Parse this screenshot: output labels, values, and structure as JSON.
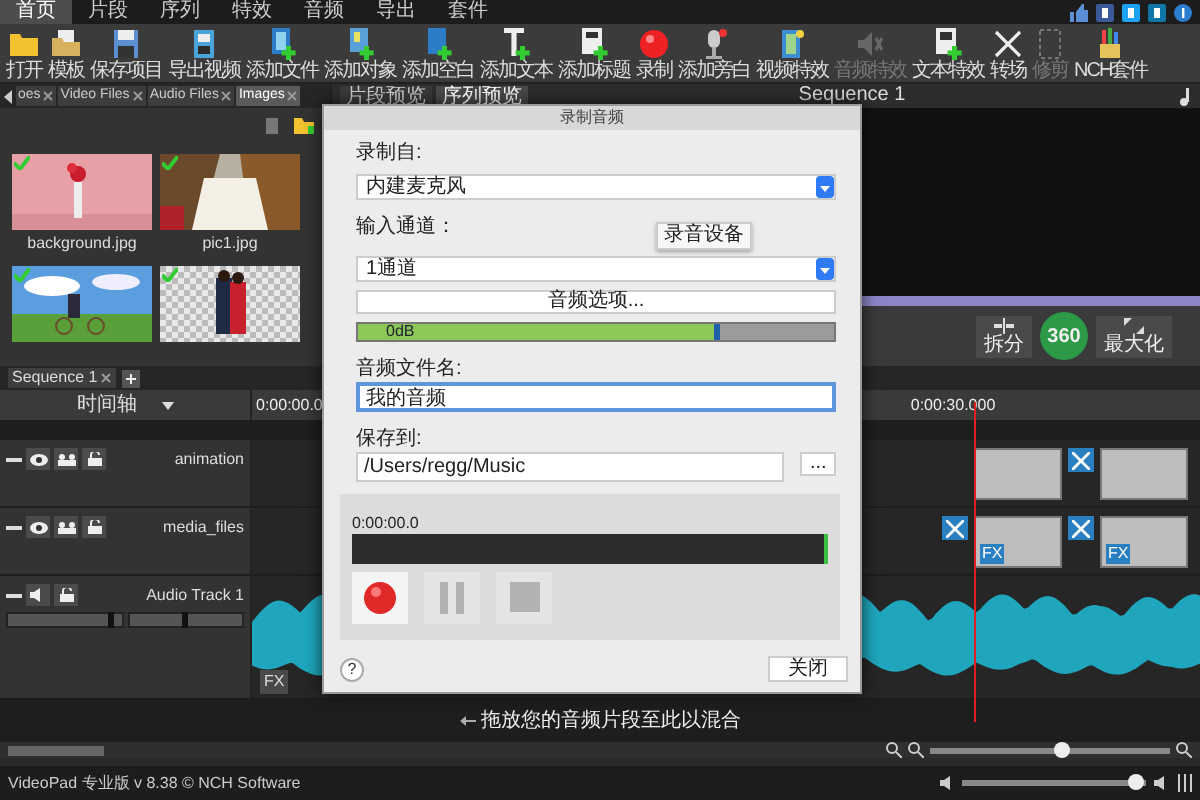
{
  "menu_tabs": [
    {
      "label": "首页",
      "selected": true
    },
    {
      "label": "片段",
      "selected": false
    },
    {
      "label": "序列",
      "selected": false
    },
    {
      "label": "特效",
      "selected": false
    },
    {
      "label": "音频",
      "selected": false
    },
    {
      "label": "导出",
      "selected": false
    },
    {
      "label": "套件",
      "selected": false
    }
  ],
  "toolbar": [
    {
      "label": "打开",
      "kind": "open",
      "disabled": false
    },
    {
      "label": "模板",
      "kind": "template",
      "disabled": false
    },
    {
      "label": "保存项目",
      "kind": "save",
      "disabled": false
    },
    {
      "label": "导出视频",
      "kind": "export",
      "disabled": false
    },
    {
      "label": "添加文件",
      "kind": "addfile",
      "disabled": false
    },
    {
      "label": "添加对象",
      "kind": "addobject",
      "disabled": false
    },
    {
      "label": "添加空白",
      "kind": "addblank",
      "disabled": false
    },
    {
      "label": "添加文本",
      "kind": "addtext",
      "disabled": false
    },
    {
      "label": "添加标题",
      "kind": "addtitle",
      "disabled": false
    },
    {
      "label": "录制",
      "kind": "record",
      "disabled": false
    },
    {
      "label": "添加旁白",
      "kind": "narration",
      "disabled": false
    },
    {
      "label": "视频特效",
      "kind": "vfx",
      "disabled": false
    },
    {
      "label": "音频特效",
      "kind": "afx",
      "disabled": true
    },
    {
      "label": "文本特效",
      "kind": "tfx",
      "disabled": false
    },
    {
      "label": "转场",
      "kind": "transition",
      "disabled": false
    },
    {
      "label": "修剪",
      "kind": "trim",
      "disabled": true
    },
    {
      "label": "NCH套件",
      "kind": "suite",
      "disabled": false
    }
  ],
  "media_tabs": [
    {
      "label": "oes",
      "selected": false
    },
    {
      "label": "Video Files",
      "selected": false
    },
    {
      "label": "Audio Files",
      "selected": false
    },
    {
      "label": "Images",
      "selected": true
    }
  ],
  "media_items": [
    {
      "caption": "background.jpg",
      "checked": true,
      "kind": "wall"
    },
    {
      "caption": "pic1.jpg",
      "checked": true,
      "kind": "dress"
    },
    {
      "checked": true,
      "kind": "field"
    },
    {
      "checked": true,
      "kind": "cutout"
    }
  ],
  "preview": {
    "tabs": [
      {
        "label": "片段预览",
        "selected": false
      },
      {
        "label": "序列预览",
        "selected": true
      }
    ],
    "title": "Sequence 1",
    "buttons": [
      {
        "label": "拆分",
        "kind": "split"
      },
      {
        "label": "360",
        "kind": "vr"
      },
      {
        "label": "最大化",
        "kind": "max"
      }
    ]
  },
  "timeline": {
    "sequence_tab": "Sequence 1",
    "mode": "时间轴",
    "times": [
      "0:00:00.0",
      "0:00:30.000"
    ],
    "tracks": [
      {
        "name": "animation",
        "kind": "video",
        "items": [
          {
            "kind": "clip"
          },
          {
            "kind": "transition"
          },
          {
            "kind": "clip"
          }
        ]
      },
      {
        "name": "media_files",
        "kind": "video",
        "items": [
          {
            "kind": "transition"
          },
          {
            "kind": "clip",
            "fx": "FX"
          },
          {
            "kind": "transition"
          },
          {
            "kind": "clip",
            "fx": "FX"
          }
        ]
      },
      {
        "name": "Audio Track 1",
        "kind": "audio",
        "fx": "FX",
        "volume": {
          "level": 0.92
        },
        "pan": {
          "level": 0.5
        }
      }
    ],
    "drop_hint": "拖放您的音频片段至此以混合",
    "zoom": {
      "level": 0.55
    }
  },
  "dialog": {
    "title": "录制音频",
    "source_label": "录制自:",
    "source": "内建麦克风",
    "channel_label": "输入通道：",
    "tooltip": "录音设备",
    "channel": "1通道",
    "options_button": "音频选项...",
    "meter": {
      "reading": "0dB",
      "level": 0.76
    },
    "filename_label": "音频文件名:",
    "filename": "我的音频",
    "save_label": "保存到:",
    "save_path": "/Users/regg/Music",
    "browse_button": "...",
    "time": "0:00:00.0",
    "controls": [
      {
        "kind": "record",
        "disabled": false
      },
      {
        "kind": "pause",
        "disabled": true
      },
      {
        "kind": "stop",
        "disabled": true
      }
    ],
    "help": "?",
    "close_button": "关闭"
  },
  "status_bar": {
    "text": "VideoPad 专业版 v 8.38 © NCH Software",
    "volume": {
      "level": 0.95
    }
  }
}
